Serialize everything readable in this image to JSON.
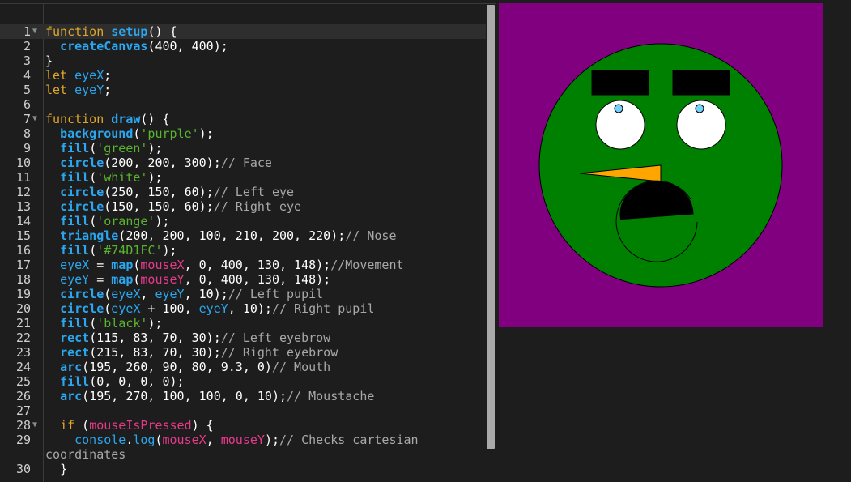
{
  "editor": {
    "lines": [
      {
        "n": "1",
        "fold": true,
        "active": true,
        "t": [
          [
            "kw",
            "function "
          ],
          [
            "fn",
            "setup"
          ],
          [
            "",
            "() {"
          ]
        ]
      },
      {
        "n": "2",
        "t": [
          [
            "",
            "  "
          ],
          [
            "fn",
            "createCanvas"
          ],
          [
            "",
            "(400, 400);"
          ]
        ]
      },
      {
        "n": "3",
        "t": [
          [
            "",
            "}"
          ]
        ]
      },
      {
        "n": "4",
        "t": [
          [
            "kw",
            "let "
          ],
          [
            "vr",
            "eyeX"
          ],
          [
            "",
            ";"
          ]
        ]
      },
      {
        "n": "5",
        "t": [
          [
            "kw",
            "let "
          ],
          [
            "vr",
            "eyeY"
          ],
          [
            "",
            ";"
          ]
        ]
      },
      {
        "n": "6",
        "t": []
      },
      {
        "n": "7",
        "fold": true,
        "t": [
          [
            "kw",
            "function "
          ],
          [
            "fn",
            "draw"
          ],
          [
            "",
            "() {"
          ]
        ]
      },
      {
        "n": "8",
        "t": [
          [
            "",
            "  "
          ],
          [
            "fn",
            "background"
          ],
          [
            "",
            "("
          ],
          [
            "st",
            "'purple'"
          ],
          [
            "",
            ");"
          ]
        ]
      },
      {
        "n": "9",
        "t": [
          [
            "",
            "  "
          ],
          [
            "fn",
            "fill"
          ],
          [
            "",
            "("
          ],
          [
            "st",
            "'green'"
          ],
          [
            "",
            ");"
          ]
        ]
      },
      {
        "n": "10",
        "t": [
          [
            "",
            "  "
          ],
          [
            "fn",
            "circle"
          ],
          [
            "",
            "(200, 200, 300);"
          ],
          [
            "cm",
            "// Face"
          ]
        ]
      },
      {
        "n": "11",
        "t": [
          [
            "",
            "  "
          ],
          [
            "fn",
            "fill"
          ],
          [
            "",
            "("
          ],
          [
            "st",
            "'white'"
          ],
          [
            "",
            ");"
          ]
        ]
      },
      {
        "n": "12",
        "t": [
          [
            "",
            "  "
          ],
          [
            "fn",
            "circle"
          ],
          [
            "",
            "(250, 150, 60);"
          ],
          [
            "cm",
            "// Left eye"
          ]
        ]
      },
      {
        "n": "13",
        "t": [
          [
            "",
            "  "
          ],
          [
            "fn",
            "circle"
          ],
          [
            "",
            "(150, 150, 60);"
          ],
          [
            "cm",
            "// Right eye"
          ]
        ]
      },
      {
        "n": "14",
        "t": [
          [
            "",
            "  "
          ],
          [
            "fn",
            "fill"
          ],
          [
            "",
            "("
          ],
          [
            "st",
            "'orange'"
          ],
          [
            "",
            ");"
          ]
        ]
      },
      {
        "n": "15",
        "t": [
          [
            "",
            "  "
          ],
          [
            "fn",
            "triangle"
          ],
          [
            "",
            "(200, 200, 100, 210, 200, 220);"
          ],
          [
            "cm",
            "// Nose"
          ]
        ]
      },
      {
        "n": "16",
        "t": [
          [
            "",
            "  "
          ],
          [
            "fn",
            "fill"
          ],
          [
            "",
            "("
          ],
          [
            "st",
            "'#74D1FC'"
          ],
          [
            "",
            ");"
          ]
        ]
      },
      {
        "n": "17",
        "t": [
          [
            "",
            "  "
          ],
          [
            "vr",
            "eyeX"
          ],
          [
            "",
            " = "
          ],
          [
            "fn",
            "map"
          ],
          [
            "",
            "("
          ],
          [
            "pk",
            "mouseX"
          ],
          [
            "",
            ", 0, 400, 130, 148);"
          ],
          [
            "cm",
            "//Movement"
          ]
        ]
      },
      {
        "n": "18",
        "t": [
          [
            "",
            "  "
          ],
          [
            "vr",
            "eyeY"
          ],
          [
            "",
            " = "
          ],
          [
            "fn",
            "map"
          ],
          [
            "",
            "("
          ],
          [
            "pk",
            "mouseY"
          ],
          [
            "",
            ", 0, 400, 130, 148);"
          ]
        ]
      },
      {
        "n": "19",
        "t": [
          [
            "",
            "  "
          ],
          [
            "fn",
            "circle"
          ],
          [
            "",
            "("
          ],
          [
            "vr",
            "eyeX"
          ],
          [
            "",
            ", "
          ],
          [
            "vr",
            "eyeY"
          ],
          [
            "",
            ", 10);"
          ],
          [
            "cm",
            "// Left pupil"
          ]
        ]
      },
      {
        "n": "20",
        "t": [
          [
            "",
            "  "
          ],
          [
            "fn",
            "circle"
          ],
          [
            "",
            "("
          ],
          [
            "vr",
            "eyeX"
          ],
          [
            "",
            " + 100, "
          ],
          [
            "vr",
            "eyeY"
          ],
          [
            "",
            ", 10);"
          ],
          [
            "cm",
            "// Right pupil"
          ]
        ]
      },
      {
        "n": "21",
        "t": [
          [
            "",
            "  "
          ],
          [
            "fn",
            "fill"
          ],
          [
            "",
            "("
          ],
          [
            "st",
            "'black'"
          ],
          [
            "",
            ");"
          ]
        ]
      },
      {
        "n": "22",
        "t": [
          [
            "",
            "  "
          ],
          [
            "fn",
            "rect"
          ],
          [
            "",
            "(115, 83, 70, 30);"
          ],
          [
            "cm",
            "// Left eyebrow"
          ]
        ]
      },
      {
        "n": "23",
        "t": [
          [
            "",
            "  "
          ],
          [
            "fn",
            "rect"
          ],
          [
            "",
            "(215, 83, 70, 30);"
          ],
          [
            "cm",
            "// Right eyebrow"
          ]
        ]
      },
      {
        "n": "24",
        "t": [
          [
            "",
            "  "
          ],
          [
            "fn",
            "arc"
          ],
          [
            "",
            "(195, 260, 90, 80, 9.3, 0)"
          ],
          [
            "cm",
            "// Mouth"
          ]
        ]
      },
      {
        "n": "25",
        "t": [
          [
            "",
            "  "
          ],
          [
            "fn",
            "fill"
          ],
          [
            "",
            "(0, 0, 0, 0);"
          ]
        ]
      },
      {
        "n": "26",
        "t": [
          [
            "",
            "  "
          ],
          [
            "fn",
            "arc"
          ],
          [
            "",
            "(195, 270, 100, 100, 0, 10);"
          ],
          [
            "cm",
            "// Moustache"
          ]
        ]
      },
      {
        "n": "27",
        "t": []
      },
      {
        "n": "28",
        "fold": true,
        "t": [
          [
            "",
            "  "
          ],
          [
            "kw",
            "if "
          ],
          [
            "",
            "("
          ],
          [
            "pk",
            "mouseIsPressed"
          ],
          [
            "",
            ") {"
          ]
        ]
      },
      {
        "n": "29",
        "wrap": true,
        "t": [
          [
            "",
            "    "
          ],
          [
            "bi",
            "console"
          ],
          [
            "",
            "."
          ],
          [
            "bi",
            "log"
          ],
          [
            "",
            "("
          ],
          [
            "pk",
            "mouseX"
          ],
          [
            "",
            ", "
          ],
          [
            "pk",
            "mouseY"
          ],
          [
            "",
            ");"
          ],
          [
            "cm",
            "// Checks cartesian coordinates"
          ]
        ]
      },
      {
        "n": "30",
        "t": [
          [
            "",
            "  }"
          ]
        ]
      }
    ]
  },
  "canvas": {
    "colors": {
      "background": "#800080",
      "face": "#008000",
      "eye": "#ffffff",
      "nose": "#ffa500",
      "pupil": "#74D1FC",
      "black": "#000000"
    }
  }
}
